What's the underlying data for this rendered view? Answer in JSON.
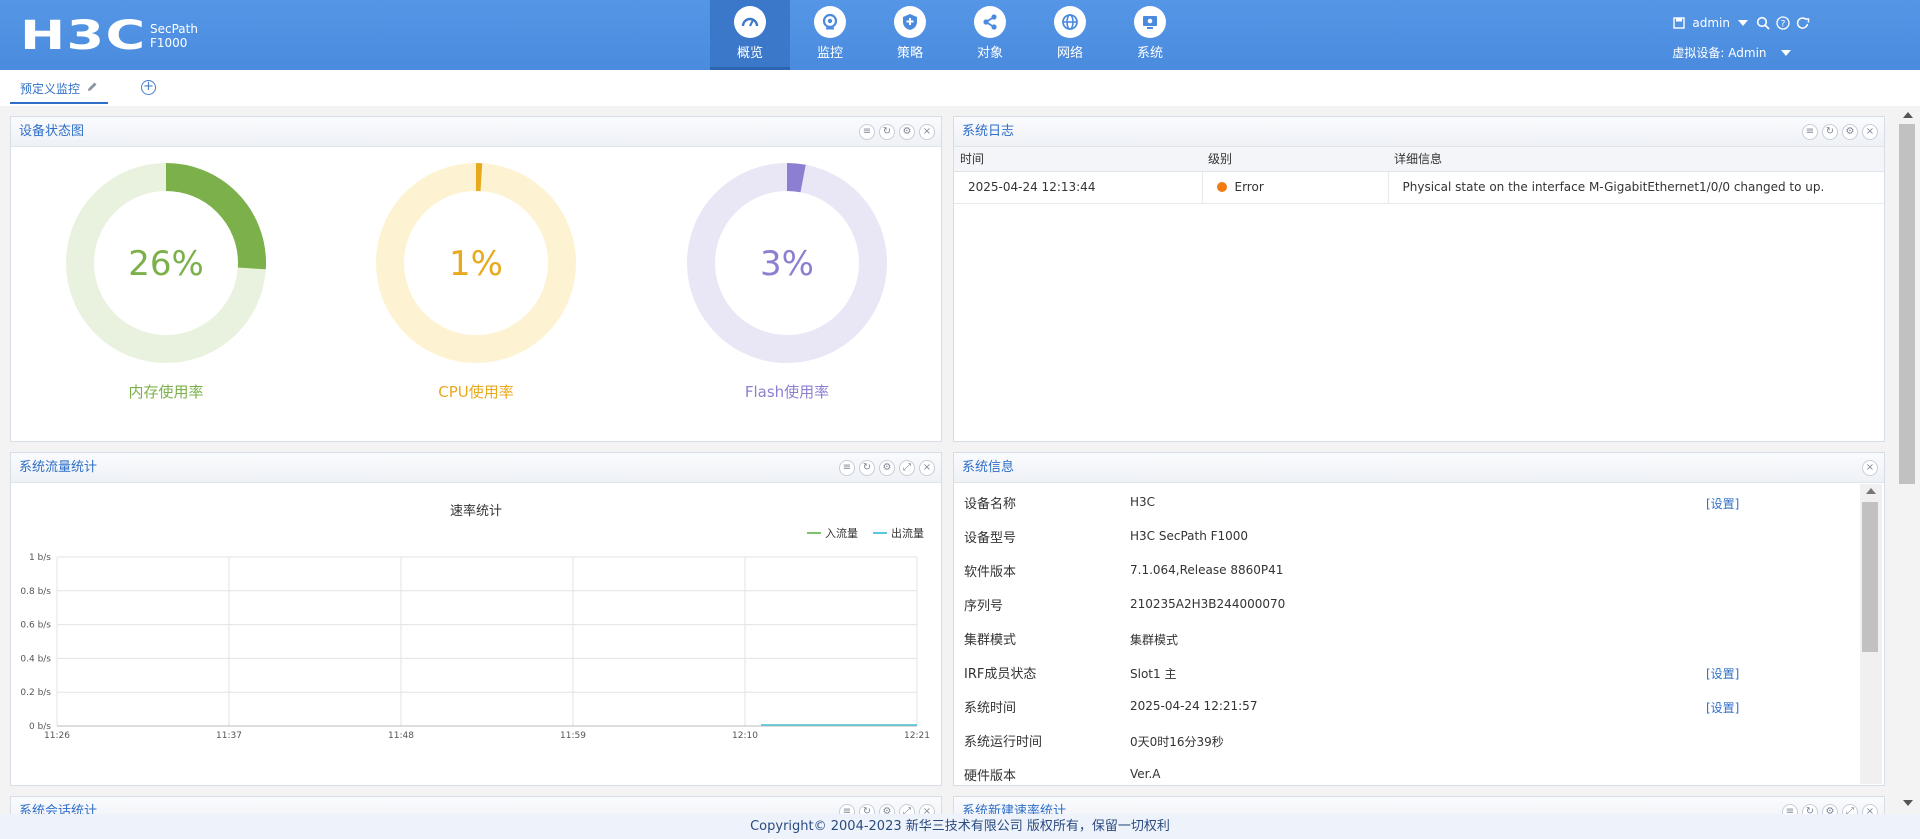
{
  "brand": {
    "logo": "H3C",
    "product_line1": "SecPath",
    "product_line2": "F1000"
  },
  "nav": [
    {
      "label": "概览",
      "icon": "dashboard-icon",
      "active": true
    },
    {
      "label": "监控",
      "icon": "monitor-icon",
      "active": false
    },
    {
      "label": "策略",
      "icon": "shield-icon",
      "active": false
    },
    {
      "label": "对象",
      "icon": "share-icon",
      "active": false
    },
    {
      "label": "网络",
      "icon": "globe-icon",
      "active": false
    },
    {
      "label": "系统",
      "icon": "system-icon",
      "active": false
    }
  ],
  "user": {
    "name": "admin",
    "vdev_label": "虚拟设备:",
    "vdev_value": "Admin"
  },
  "tabs": {
    "active_label": "预定义监控",
    "add_symbol": "+"
  },
  "device_status": {
    "title": "设备状态图",
    "gauges": [
      {
        "label": "内存使用率",
        "value": 26,
        "text": "26%",
        "color": "#7cb04a",
        "track": "#e8f2de"
      },
      {
        "label": "CPU使用率",
        "value": 1,
        "text": "1%",
        "color": "#e9a91c",
        "track": "#fdf3d3"
      },
      {
        "label": "Flash使用率",
        "value": 3,
        "text": "3%",
        "color": "#8c7fd1",
        "track": "#e9e6f6"
      }
    ]
  },
  "syslog": {
    "title": "系统日志",
    "columns": [
      "时间",
      "级别",
      "详细信息"
    ],
    "rows": [
      {
        "time": "2025-04-24 12:13:44",
        "level": "Error",
        "detail": "Physical state on the interface M-GigabitEthernet1/0/0 changed to up."
      }
    ]
  },
  "traffic": {
    "title": "系统流量统计",
    "chart_title": "速率统计",
    "legend_in": "入流量",
    "legend_out": "出流量"
  },
  "chart_data": {
    "type": "line",
    "title": "速率统计",
    "x": [
      "11:26",
      "11:37",
      "11:48",
      "11:59",
      "12:10",
      "12:21"
    ],
    "y_ticks": [
      "0 b/s",
      "0.2 b/s",
      "0.4 b/s",
      "0.6 b/s",
      "0.8 b/s",
      "1 b/s"
    ],
    "ylim": [
      0,
      1
    ],
    "series": [
      {
        "name": "入流量",
        "color": "#7cc46a",
        "x_start": "12:10",
        "x_end": "12:21",
        "y": 0
      },
      {
        "name": "出流量",
        "color": "#5ac8e0",
        "x_start": "12:10",
        "x_end": "12:21",
        "y": 0
      }
    ],
    "legend_position": "top-right",
    "grid": true
  },
  "sysinfo": {
    "title": "系统信息",
    "rows": [
      {
        "key": "设备名称",
        "value": "H3C",
        "action": "[设置]"
      },
      {
        "key": "设备型号",
        "value": "H3C SecPath F1000",
        "action": ""
      },
      {
        "key": "软件版本",
        "value": "7.1.064,Release 8860P41",
        "action": ""
      },
      {
        "key": "序列号",
        "value": "210235A2H3B244000070",
        "action": ""
      },
      {
        "key": "集群模式",
        "value": "集群模式",
        "action": ""
      },
      {
        "key": "IRF成员状态",
        "value": "Slot1 主",
        "action": "[设置]"
      },
      {
        "key": "系统时间",
        "value": "2025-04-24 12:21:57",
        "action": "[设置]"
      },
      {
        "key": "系统运行时间",
        "value": "0天0时16分39秒",
        "action": ""
      },
      {
        "key": "硬件版本",
        "value": "Ver.A",
        "action": ""
      }
    ]
  },
  "bottom_panels": {
    "left_title": "系统会话统计",
    "right_title": "系统新建速率统计"
  },
  "footer": {
    "text": "Copyright© 2004-2023 新华三技术有限公司 版权所有，保留一切权利"
  }
}
